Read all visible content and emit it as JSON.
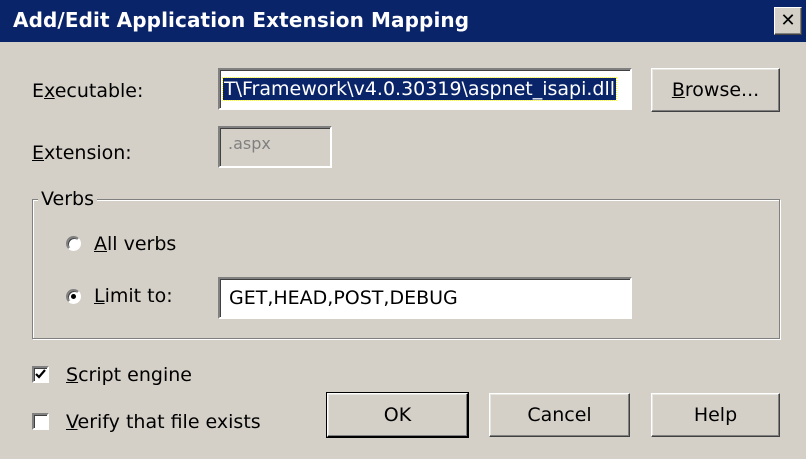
{
  "window": {
    "title": "Add/Edit Application Extension Mapping",
    "close_glyph": "✕",
    "title_bar_color": "#0a246a",
    "face_color": "#d4d0c8"
  },
  "executable": {
    "label_pre": "E",
    "label_mnemonic": "x",
    "label_post": "ecutable:",
    "value": "T\\Framework\\v4.0.30319\\aspnet_isapi.dll"
  },
  "browse_button": {
    "mnemonic": "B",
    "rest": "rowse..."
  },
  "extension": {
    "label_mnemonic": "E",
    "label_post": "xtension:",
    "value": ".aspx"
  },
  "verbs": {
    "group_title": "Verbs",
    "all_verbs": {
      "mnemonic": "A",
      "rest": "ll verbs",
      "selected": false
    },
    "limit_to": {
      "mnemonic": "L",
      "rest": "imit to:",
      "selected": true
    },
    "limit_value": "GET,HEAD,POST,DEBUG"
  },
  "script_engine": {
    "mnemonic": "S",
    "rest": "cript engine",
    "checked": true
  },
  "verify_file": {
    "mnemonic": "V",
    "rest": "erify that file exists",
    "checked": false
  },
  "buttons": {
    "ok": "OK",
    "cancel": "Cancel",
    "help": "Help"
  }
}
